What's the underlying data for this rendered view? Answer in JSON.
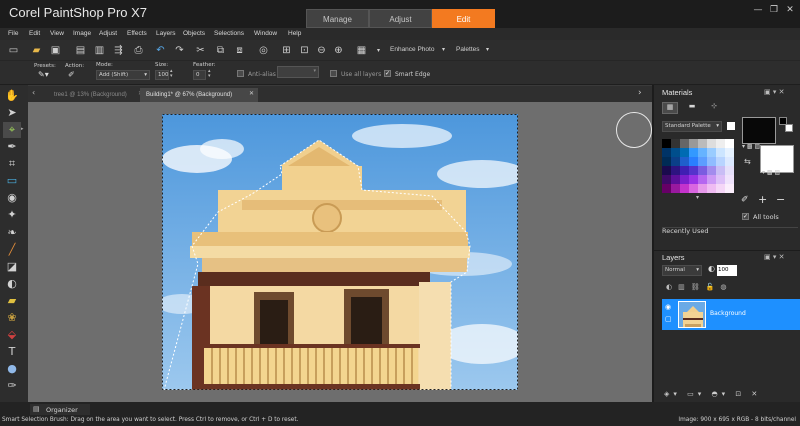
{
  "app": {
    "title": "Corel PaintShop Pro X7"
  },
  "mode_tabs": [
    {
      "label": "Manage"
    },
    {
      "label": "Adjust"
    },
    {
      "label": "Edit"
    }
  ],
  "menu": [
    "File",
    "Edit",
    "View",
    "Image",
    "Adjust",
    "Effects",
    "Layers",
    "Objects",
    "Selections",
    "Window",
    "Help"
  ],
  "toolbar": {
    "enhance_photo": "Enhance Photo",
    "palettes": "Palettes"
  },
  "options": {
    "presets_label": "Presets:",
    "action_label": "Action:",
    "mode_label": "Mode:",
    "mode_value": "Add (Shift)",
    "size_label": "Size:",
    "size_value": "100",
    "feather_label": "Feather:",
    "feather_value": "0",
    "anti_alias": "Anti-alias",
    "use_all_layers": "Use all layers",
    "smart_edge": "Smart Edge"
  },
  "doc_tabs": [
    {
      "label": "tree1 @  13% (Background)"
    },
    {
      "label": "Building1* @  67% (Background)"
    }
  ],
  "materials": {
    "title": "Materials",
    "palette_select": "Standard Palette",
    "all_tools": "All tools",
    "recently_used": "Recently Used"
  },
  "layers": {
    "title": "Layers",
    "blend_mode": "Normal",
    "opacity": "100",
    "layer_name": "Background"
  },
  "organizer": {
    "label": "Organizer"
  },
  "status": {
    "left": "Smart Selection Brush: Drag on the area you want to select. Press Ctrl to remove, or Ctrl + D to reset.",
    "right": "Image:  900 x 695 x RGB - 8 bits/channel"
  },
  "colors": {
    "accent": "#f37a20",
    "selected_layer": "#1e90ff",
    "canvas_bg": "#6e6e6e"
  }
}
